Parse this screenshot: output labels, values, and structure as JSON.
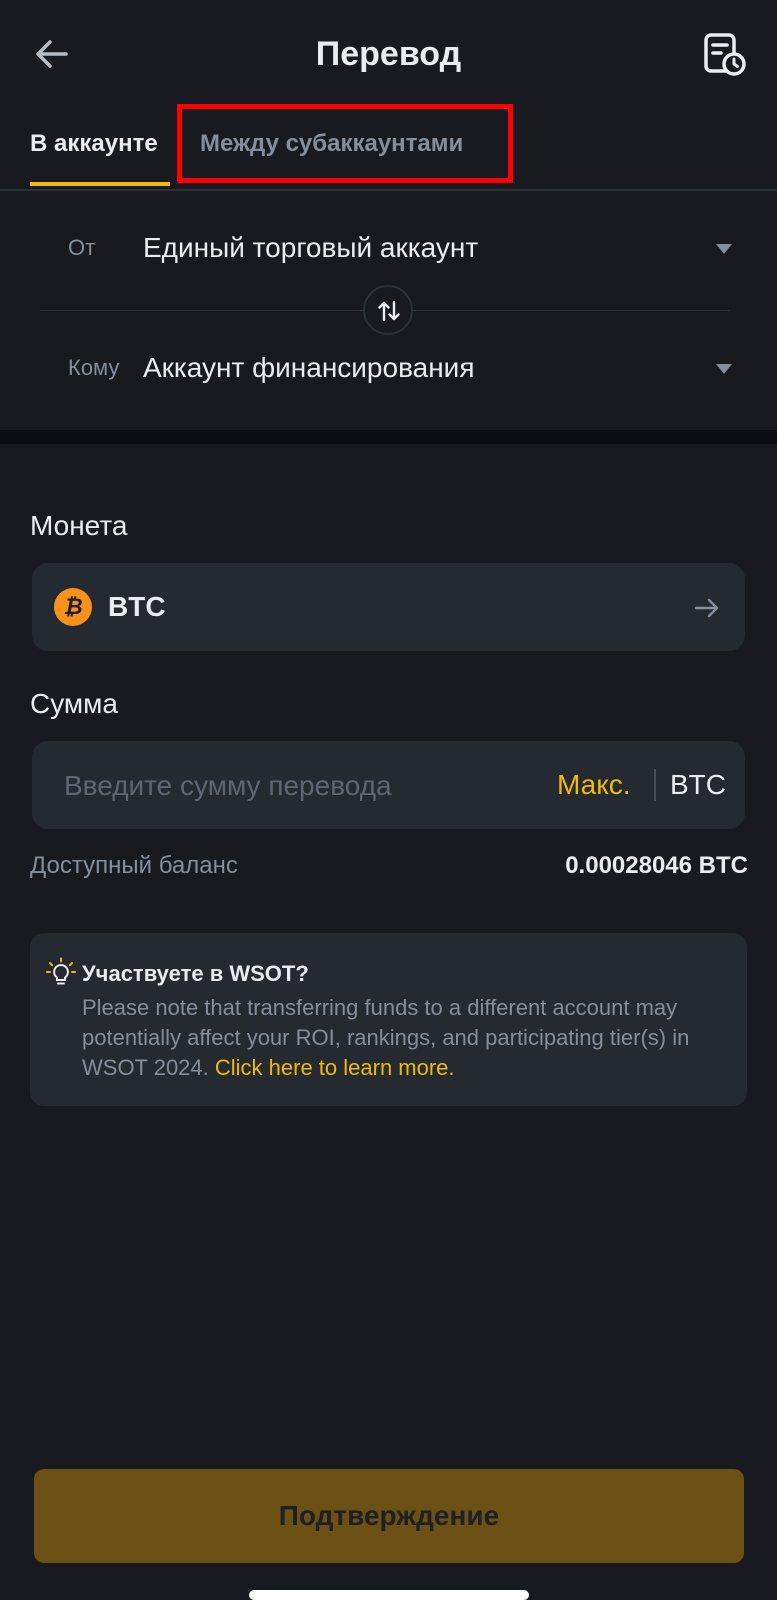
{
  "header": {
    "title": "Перевод",
    "back_icon": "arrow-left-icon",
    "history_icon": "transfer-history-icon"
  },
  "tabs": [
    {
      "label": "В аккаунте",
      "active": true
    },
    {
      "label": "Между субаккаунтами",
      "active": false,
      "highlighted": true
    }
  ],
  "route": {
    "from_label": "От",
    "from_value": "Единый торговый аккаунт",
    "to_label": "Кому",
    "to_value": "Аккаунт финансирования",
    "swap_icon": "swap-vertical-icon"
  },
  "coin": {
    "label": "Монета",
    "symbol": "BTC",
    "icon_glyph": "₿",
    "icon": "bitcoin-icon",
    "icon_color": "#f7931a"
  },
  "amount": {
    "label": "Сумма",
    "placeholder": "Введите сумму перевода",
    "value": "",
    "max_label": "Макс.",
    "unit": "BTC"
  },
  "balance": {
    "label": "Доступный баланс",
    "value": "0.00028046 BTC"
  },
  "notice": {
    "icon": "lightbulb-icon",
    "title": "Участвуете в WSOT?",
    "body": "Please note that transferring funds to a different account may potentially affect your ROI, rankings, and participating tier(s) in WSOT 2024. ",
    "link": "Click here to learn more."
  },
  "confirm": {
    "label": "Подтверждение"
  },
  "colors": {
    "background": "#181a20",
    "accent": "#f0b90b",
    "highlight_border": "#ff0000",
    "muted_text": "#848e9c",
    "field_bg": "#252930"
  }
}
